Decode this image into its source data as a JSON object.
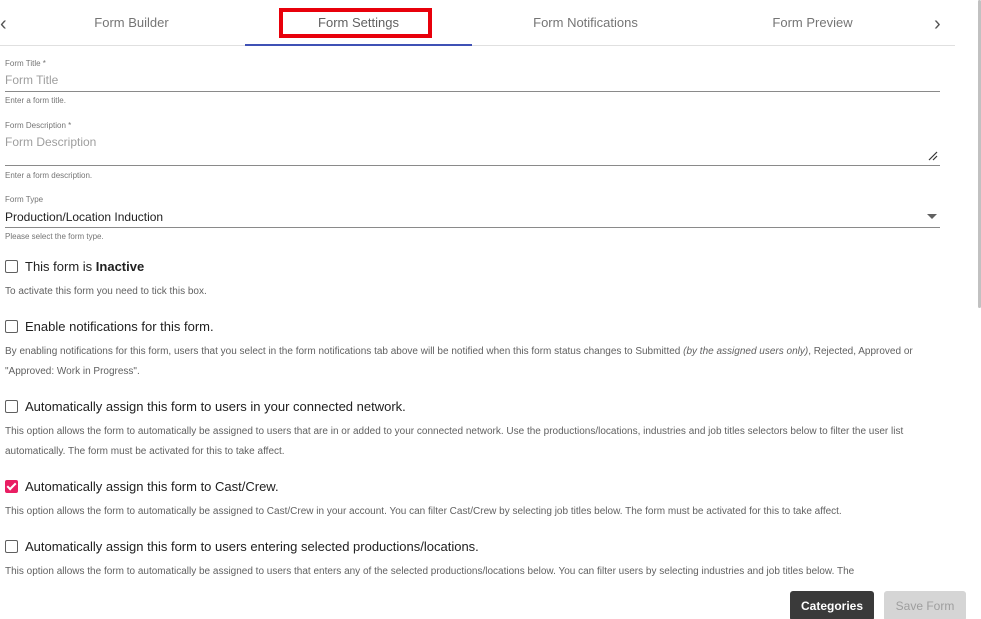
{
  "tabs": {
    "items": [
      "Form Builder",
      "Form Settings",
      "Form Notifications",
      "Form Preview"
    ],
    "active": "Form Settings"
  },
  "fields": {
    "title": {
      "label": "Form Title *",
      "placeholder": "Form Title",
      "hint": "Enter a form title."
    },
    "description": {
      "label": "Form Description *",
      "placeholder": "Form Description",
      "hint": "Enter a form description."
    },
    "type": {
      "label": "Form Type",
      "value": "Production/Location Induction",
      "hint": "Please select the form type."
    }
  },
  "options": {
    "inactive": {
      "label_prefix": "This form is ",
      "label_bold": "Inactive",
      "checked": false,
      "description": "To activate this form you need to tick this box."
    },
    "notifications": {
      "label": "Enable notifications for this form.",
      "checked": false,
      "description_pre": "By enabling notifications for this form, users that you select in the form notifications tab above will be notified when this form status changes to Submitted ",
      "description_italic": "(by the assigned users only)",
      "description_post": ", Rejected, Approved or \"Approved: Work in Progress\"."
    },
    "network": {
      "label": "Automatically assign this form to users in your connected network.",
      "checked": false,
      "description": "This option allows the form to automatically be assigned to users that are in or added to your connected network. Use the productions/locations, industries and job titles selectors below to filter the user list automatically. The form must be activated for this to take affect."
    },
    "cast_crew": {
      "label": "Automatically assign this form to Cast/Crew.",
      "checked": true,
      "description": "This option allows the form to automatically be assigned to Cast/Crew in your account. You can filter Cast/Crew by selecting job titles below. The form must be activated for this to take affect."
    },
    "productions": {
      "label": "Automatically assign this form to users entering selected productions/locations.",
      "checked": false,
      "description": "This option allows the form to automatically be assigned to users that enters any of the selected productions/locations below. You can filter users by selecting industries and job titles below. The"
    }
  },
  "buttons": {
    "categories": "Categories",
    "save": "Save Form"
  },
  "colors": {
    "accent_tab": "#3f51b5",
    "checkbox_checked": "#e91e63",
    "highlight": "#e8000b",
    "primary_button": "#3a3a3a"
  }
}
